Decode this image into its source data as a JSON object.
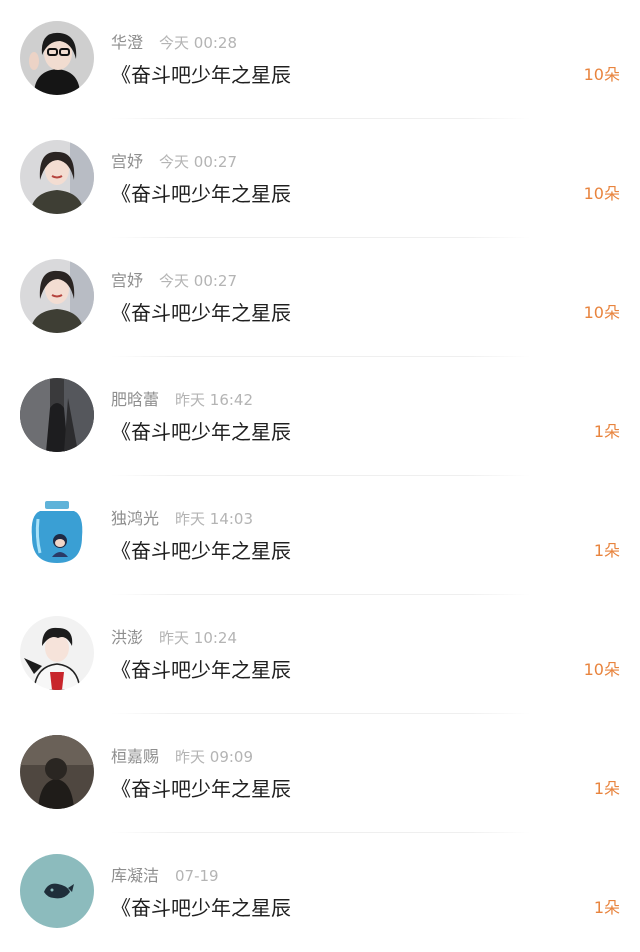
{
  "accent_color": "#e8843e",
  "records": [
    {
      "name": "华澄",
      "time": "今天 00:28",
      "work": "《奋斗吧少年之星辰",
      "flowers": "10朵"
    },
    {
      "name": "宫妤",
      "time": "今天 00:27",
      "work": "《奋斗吧少年之星辰",
      "flowers": "10朵"
    },
    {
      "name": "宫妤",
      "time": "今天 00:27",
      "work": "《奋斗吧少年之星辰",
      "flowers": "10朵"
    },
    {
      "name": "肥晗蕾",
      "time": "昨天 16:42",
      "work": "《奋斗吧少年之星辰",
      "flowers": "1朵"
    },
    {
      "name": "独鸿光",
      "time": "昨天 14:03",
      "work": "《奋斗吧少年之星辰",
      "flowers": "1朵"
    },
    {
      "name": "洪澎",
      "time": "昨天 10:24",
      "work": "《奋斗吧少年之星辰",
      "flowers": "10朵"
    },
    {
      "name": "桓嘉赐",
      "time": "昨天 09:09",
      "work": "《奋斗吧少年之星辰",
      "flowers": "1朵"
    },
    {
      "name": "库凝洁",
      "time": "07-19",
      "work": "《奋斗吧少年之星辰",
      "flowers": "1朵"
    }
  ]
}
